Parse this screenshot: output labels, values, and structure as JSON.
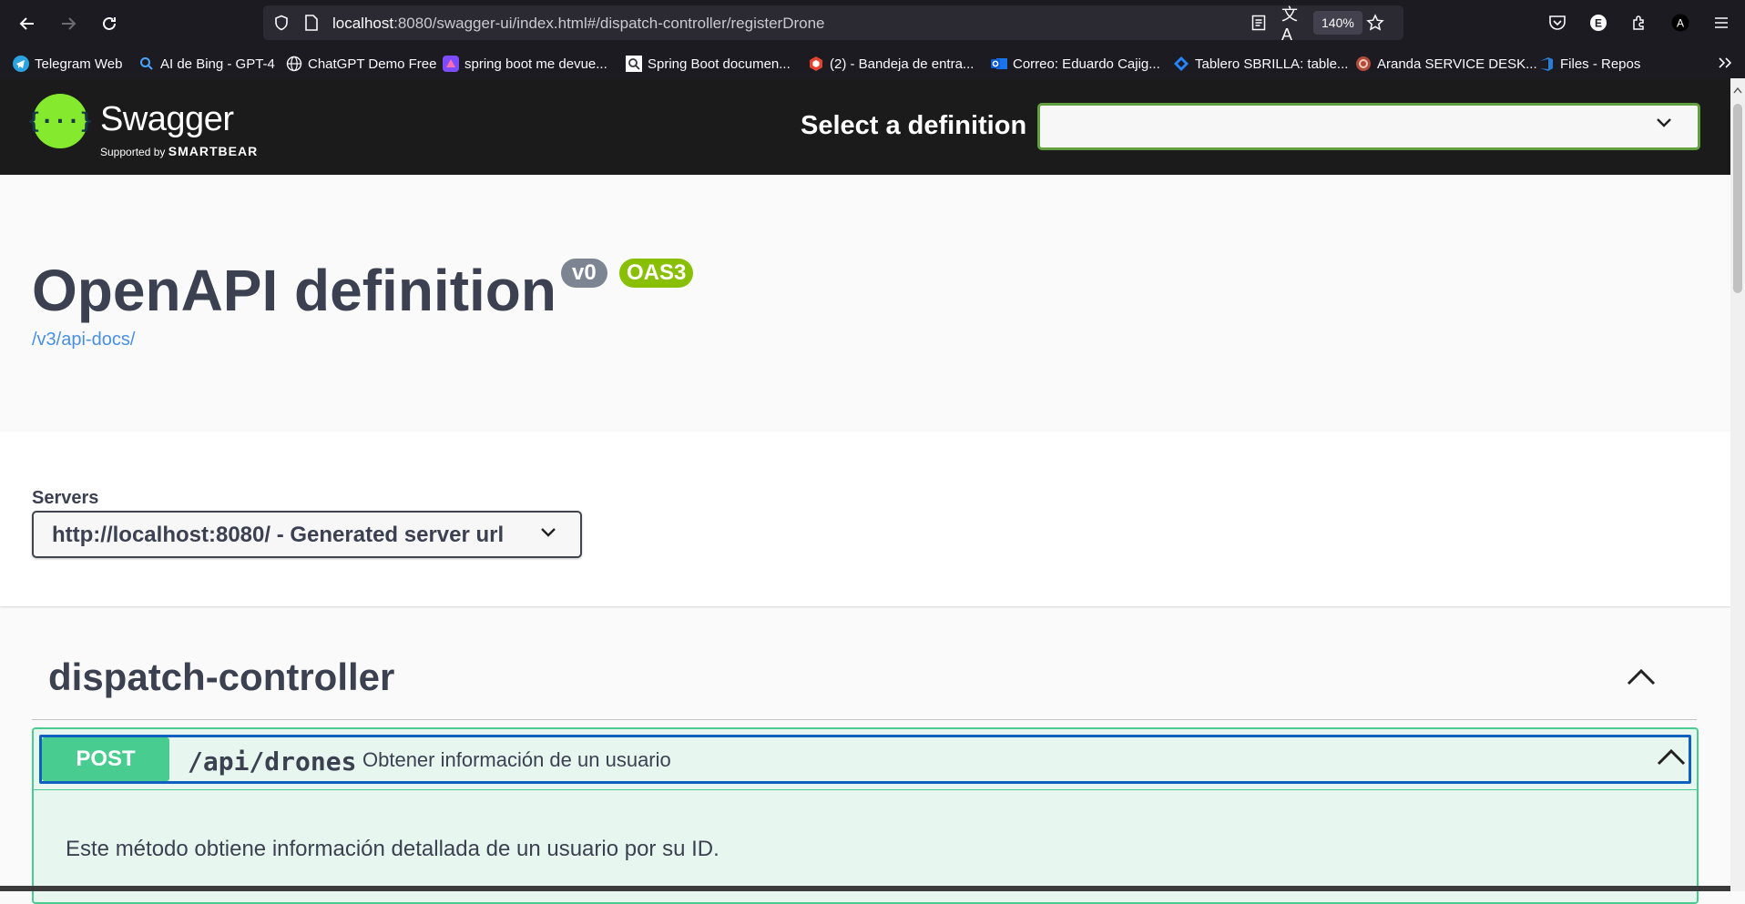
{
  "browser": {
    "url_host": "localhost",
    "url_rest": ":8080/swagger-ui/index.html#/dispatch-controller/registerDrone",
    "zoom": "140%",
    "bookmarks": [
      {
        "label": "Telegram Web",
        "icon": "telegram-icon"
      },
      {
        "label": "AI de Bing - GPT-4",
        "icon": "search-icon"
      },
      {
        "label": "ChatGPT Demo Free",
        "icon": "globe-icon"
      },
      {
        "label": "spring boot me devue...",
        "icon": "app-icon"
      },
      {
        "label": "Spring Boot documen...",
        "icon": "search-icon"
      },
      {
        "label": "(2) - Bandeja de entra...",
        "icon": "mail-icon"
      },
      {
        "label": "Correo: Eduardo Cajig...",
        "icon": "outlook-icon"
      },
      {
        "label": "Tablero SBRILLA: table...",
        "icon": "jira-icon"
      },
      {
        "label": "Aranda SERVICE DESK...",
        "icon": "aranda-icon"
      },
      {
        "label": "Files - Repos",
        "icon": "azure-icon"
      }
    ]
  },
  "swagger": {
    "logo_word": "Swagger",
    "logo_sub": "Supported by",
    "logo_brand": "SMARTBEAR",
    "def_label": "Select a definition",
    "def_value": ""
  },
  "info": {
    "title": "OpenAPI definition",
    "version": "v0",
    "oas": "OAS3",
    "link": "/v3/api-docs/"
  },
  "servers": {
    "label": "Servers",
    "selected": "http://localhost:8080/ - Generated server url"
  },
  "tag": {
    "name": "dispatch-controller"
  },
  "operation": {
    "method": "POST",
    "path": "/api/drones",
    "summary": "Obtener información de un usuario",
    "description": "Este método obtiene información detallada de un usuario por su ID."
  },
  "colors": {
    "swagger_green": "#85ea2d",
    "post_green": "#49cc90",
    "oas_badge": "#89bf04",
    "version_badge": "#7d8492",
    "link_blue": "#4990e2",
    "focus_blue": "#1060c0"
  }
}
